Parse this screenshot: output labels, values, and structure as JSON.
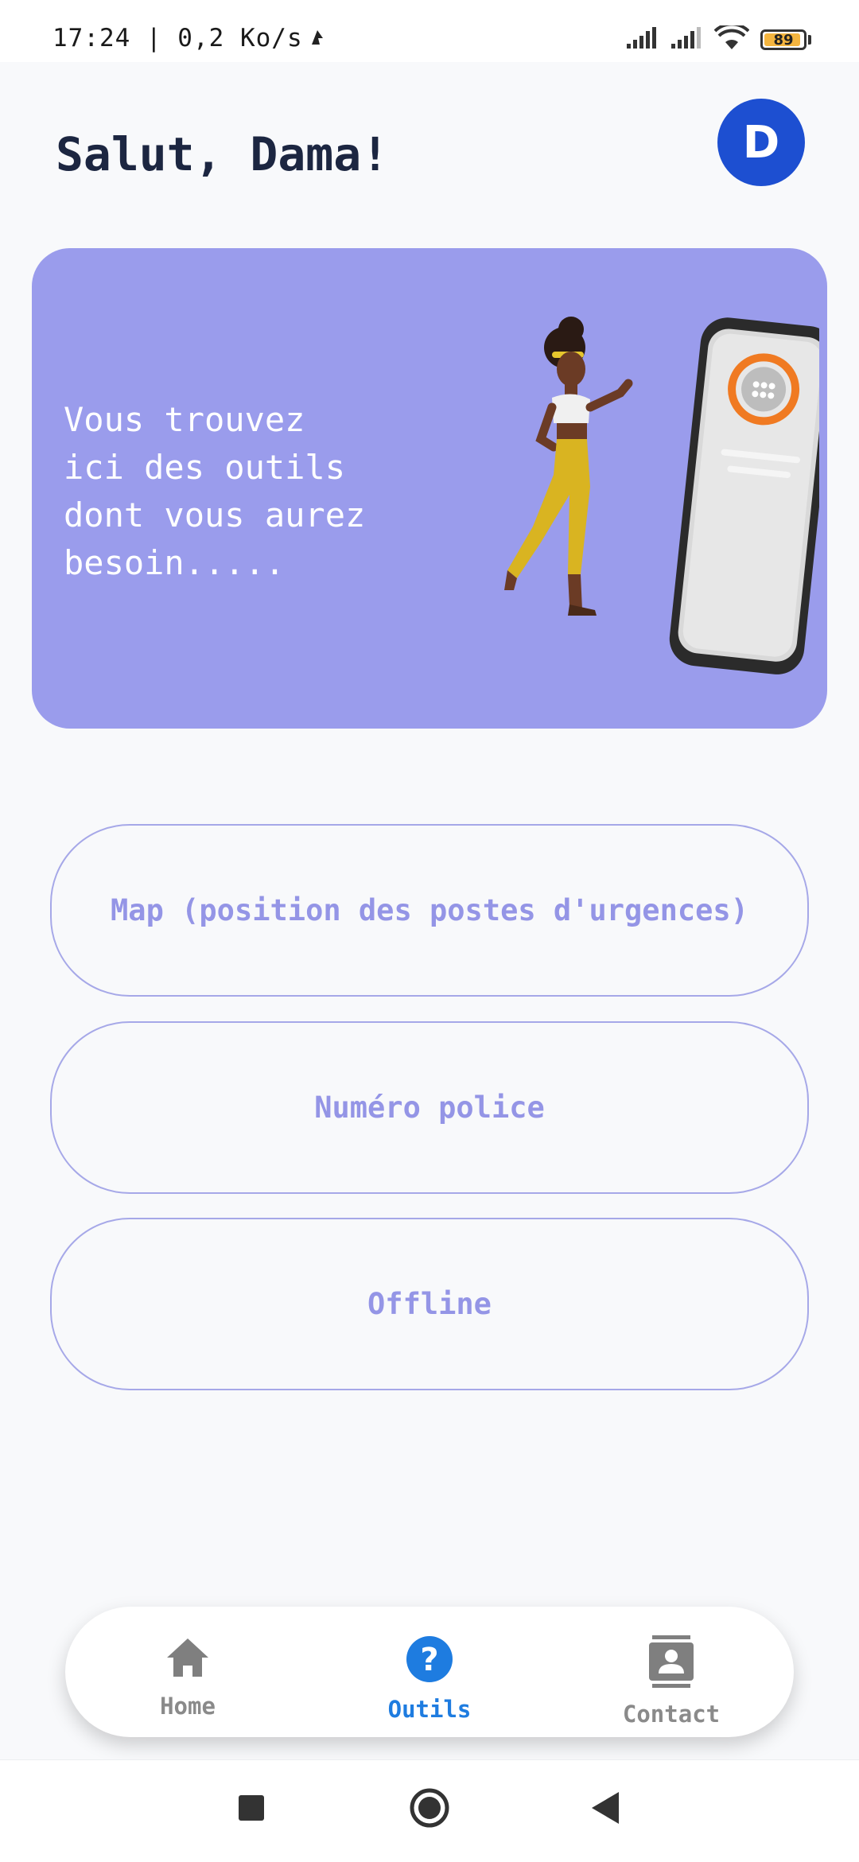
{
  "status_bar": {
    "time_speed": "17:24 | 0,2 Ko/s",
    "battery": "89"
  },
  "header": {
    "greeting": "Salut, Dama!",
    "avatar_initial": "D"
  },
  "banner": {
    "text": "Vous trouvez\nici des outils\ndont vous aurez\nbesoin.....",
    "background": "#9a9cec"
  },
  "tools": [
    {
      "label": "Map (position des postes d'urgences)"
    },
    {
      "label": "Numéro police"
    },
    {
      "label": "Offline"
    }
  ],
  "bottom_nav": {
    "items": [
      {
        "label": "Home",
        "icon": "home-icon",
        "active": false
      },
      {
        "label": "Outils",
        "icon": "help-icon",
        "active": true
      },
      {
        "label": "Contact",
        "icon": "contact-icon",
        "active": false
      }
    ],
    "active_color": "#1e7ce0",
    "inactive_color": "#8a8a8a"
  },
  "colors": {
    "accent": "#1d4fd1",
    "tool_text": "#9495e6",
    "title": "#1c2641"
  }
}
